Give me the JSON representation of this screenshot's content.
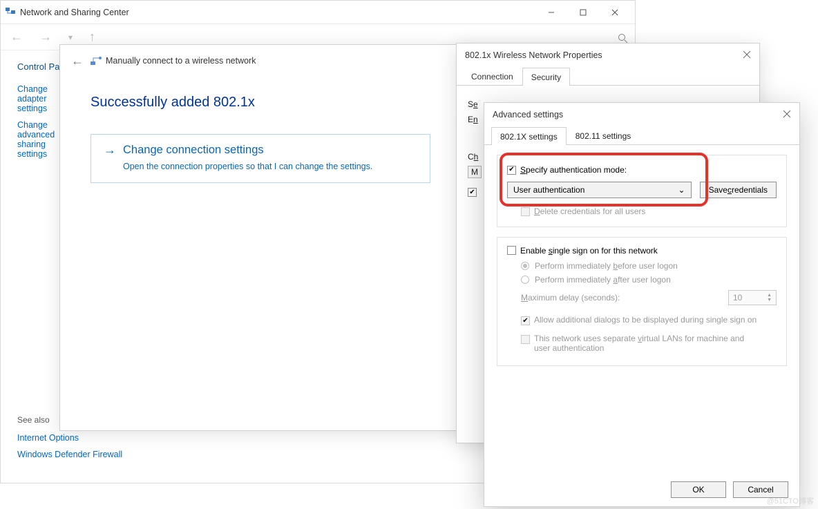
{
  "ns_window": {
    "title": "Network and Sharing Center",
    "control_panel": "Control Panel",
    "side_links": {
      "change_adapter": "Change adapter settings",
      "change_advanced": "Change advanced sharing settings"
    },
    "see_also": "See also",
    "internet_options": "Internet Options",
    "defender": "Windows Defender Firewall"
  },
  "wizard": {
    "title": "Manually connect to a wireless network",
    "heading": "Successfully added 802.1x",
    "opt_title": "Change connection settings",
    "opt_sub": "Open the connection properties so that I can change the settings."
  },
  "props": {
    "title": "802.1x Wireless Network Properties",
    "tab_connection": "Connection",
    "tab_security": "Security",
    "security_label": "Security type:",
    "encryption_label": "Encryption type:",
    "choose_label": "Choose a network authentication method:",
    "method": "Microsoft: Protected EAP (PEAP)"
  },
  "adv": {
    "title": "Advanced settings",
    "tab_8021x": "802.1X settings",
    "tab_80211": "802.11 settings",
    "specify_label": "Specify authentication mode:",
    "auth_mode": "User authentication",
    "save_creds": "Save credentials",
    "delete_creds": "Delete credentials for all users",
    "sso_enable": "Enable single sign on for this network",
    "sso_before": "Perform immediately before user logon",
    "sso_after": "Perform immediately after user logon",
    "max_delay_label": "Maximum delay (seconds):",
    "max_delay_value": "10",
    "allow_dialogs": "Allow additional dialogs to be displayed during single sign on",
    "sep_vlan": "This network uses separate virtual LANs for machine and user authentication",
    "ok": "OK",
    "cancel": "Cancel"
  },
  "watermark": "@51CTO博客"
}
